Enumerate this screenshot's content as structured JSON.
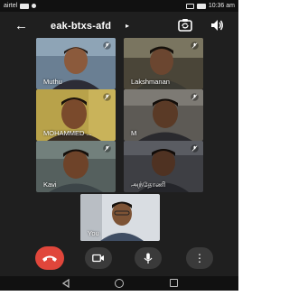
{
  "status_bar": {
    "carrier": "airtel",
    "time": "10:36 am"
  },
  "header": {
    "meeting_code": "eak-btxs-afd",
    "caret": "▸",
    "back_glyph": "←"
  },
  "participants": [
    {
      "name": "Muthu"
    },
    {
      "name": "Lakshmanan"
    },
    {
      "name": "MOHAMMED ..."
    },
    {
      "name": "M"
    },
    {
      "name": "Kavi"
    },
    {
      "name": "அந்தோணி"
    }
  ],
  "self_tile": {
    "name": "You"
  },
  "controls": {
    "more_glyph": "⋮"
  },
  "colors": {
    "end_call": "#e0463b",
    "background": "#1f1f1f"
  }
}
